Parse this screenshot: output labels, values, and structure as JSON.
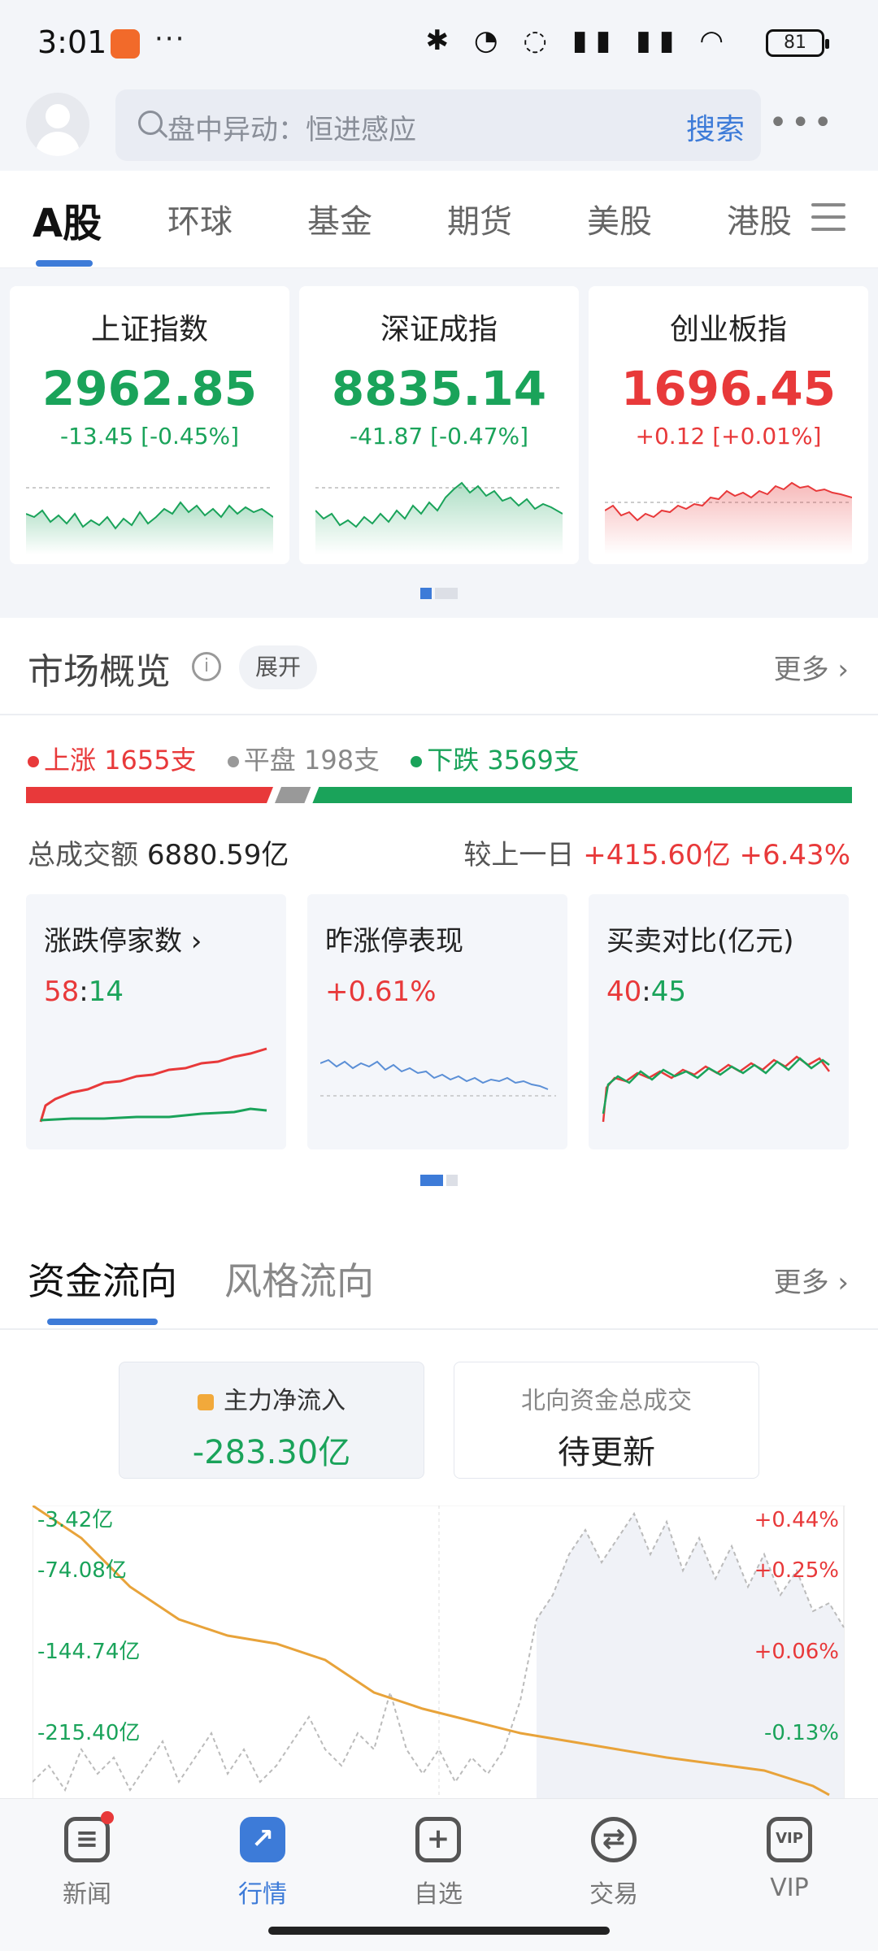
{
  "status_bar": {
    "time": "3:01",
    "more": "···",
    "battery": "81"
  },
  "search": {
    "placeholder": "盘中异动：恒进感应",
    "button": "搜索"
  },
  "market_tabs": [
    "A股",
    "环球",
    "基金",
    "期货",
    "美股",
    "港股"
  ],
  "indices": [
    {
      "name": "上证指数",
      "value": "2962.85",
      "change": "-13.45 [-0.45%]",
      "direction": "down"
    },
    {
      "name": "深证成指",
      "value": "8835.14",
      "change": "-41.87 [-0.47%]",
      "direction": "down"
    },
    {
      "name": "创业板指",
      "value": "1696.45",
      "change": "+0.12 [+0.01%]",
      "direction": "up"
    }
  ],
  "overview": {
    "title": "市场概览",
    "info": "i",
    "expand": "展开",
    "more": "更多 ›",
    "up_label": "上涨 1655支",
    "flat_label": "平盘 198支",
    "down_label": "下跌 3569支",
    "up_count": 1655,
    "flat_count": 198,
    "down_count": 3569,
    "turnover_label": "总成交额",
    "turnover_value": "6880.59亿",
    "compare_label": "较上一日",
    "compare_value": "+415.60亿 +6.43%",
    "cards": {
      "limit": {
        "title": "涨跌停家数 ›",
        "up": "58",
        "sep": ":",
        "down": "14"
      },
      "yesterday": {
        "title": "昨涨停表现",
        "value": "+0.61%"
      },
      "buysell": {
        "title": "买卖对比(亿元)",
        "buy": "40",
        "sep": ":",
        "sell": "45"
      }
    }
  },
  "fund_flow": {
    "tab_active": "资金流向",
    "tab_other": "风格流向",
    "more": "更多 ›",
    "main_label": "主力净流入",
    "main_value": "-283.30亿",
    "north_label": "北向资金总成交",
    "north_value": "待更新",
    "left_axis": [
      "-3.42亿",
      "-74.08亿",
      "-144.74亿",
      "-215.40亿"
    ],
    "right_axis": [
      "+0.44%",
      "+0.25%",
      "+0.06%",
      "-0.13%"
    ]
  },
  "bottom_nav": [
    "新闻",
    "行情",
    "自选",
    "交易",
    "VIP"
  ],
  "colors": {
    "up": "#e8393a",
    "down": "#1aa35a",
    "accent": "#3d7bd8",
    "flow": "#e8a33a"
  }
}
